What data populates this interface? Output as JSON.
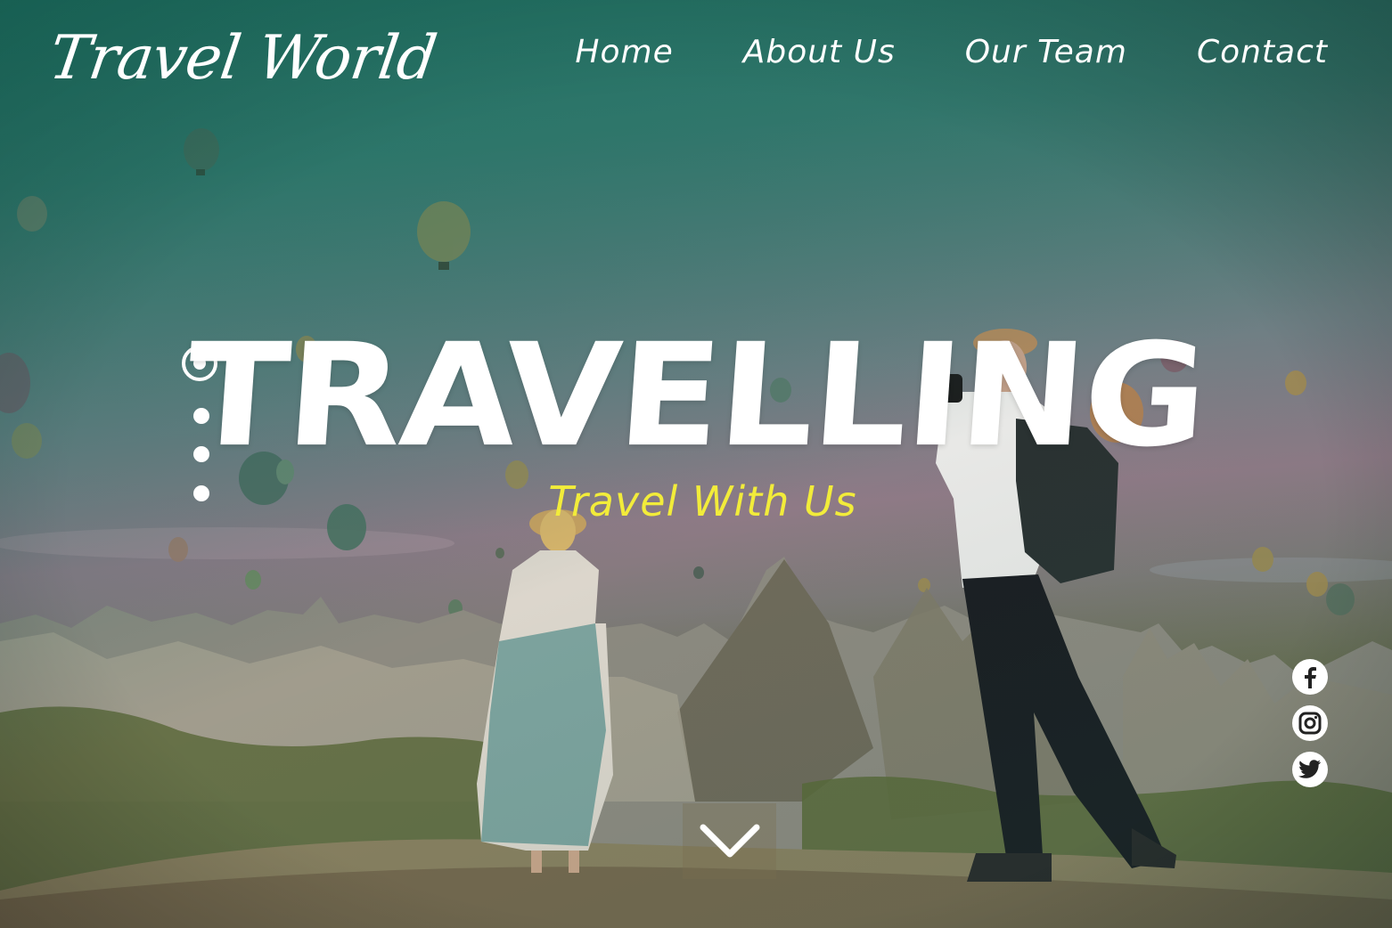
{
  "brand": {
    "logo_text": "Travel World"
  },
  "nav": {
    "items": [
      {
        "label": "Home"
      },
      {
        "label": "About Us"
      },
      {
        "label": "Our Team"
      },
      {
        "label": "Contact"
      }
    ]
  },
  "hero": {
    "title": "TRAVELLING",
    "subtitle": "Travel With Us",
    "subtitle_color": "#f2ec3a",
    "slider_dots": {
      "count": 4,
      "active_index": 0
    }
  },
  "social": {
    "icons": [
      "facebook-icon",
      "instagram-icon",
      "twitter-icon"
    ]
  },
  "scroll_button": {
    "icon": "chevron-down-icon"
  },
  "colors": {
    "text": "#ffffff",
    "accent": "#f2ec3a",
    "overlay_teal": "#2a7566"
  }
}
